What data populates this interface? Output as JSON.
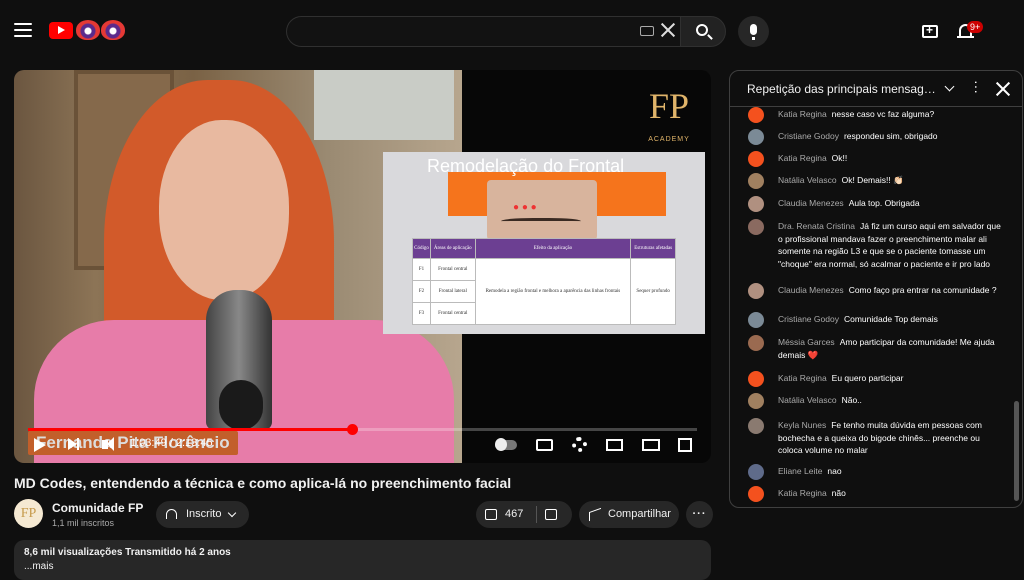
{
  "header": {
    "notification_count": "9+",
    "search_placeholder": ""
  },
  "player": {
    "slide_title": "Remodelação do Frontal",
    "logo_text": "FP",
    "logo_sub": "ACADEMY",
    "slide_table": {
      "headers": [
        "Código",
        "Áreas de aplicação",
        "Efeito da aplicação",
        "Estruturas afetadas"
      ],
      "rows": [
        [
          "F1",
          "Frontal central",
          "",
          ""
        ],
        [
          "F2",
          "Frontal lateral",
          "Remodela a região frontal e melhora a aparência das linhas frontais",
          "Sequer profundo"
        ],
        [
          "F3",
          "Frontal central",
          "",
          ""
        ]
      ]
    },
    "overlay_name": "Fernanda Pita Florêncio",
    "time_display": "1:03:49 / 2:13:45",
    "progress_fraction": 0.484
  },
  "video": {
    "title": "MD Codes, entendendo a técnica e como aplica-lá no preenchimento facial",
    "channel_name": "Comunidade FP",
    "channel_avatar": "FP",
    "subscribers": "1,1 mil inscritos",
    "subscribe_label": "Inscrito",
    "likes": "467",
    "share_label": "Compartilhar",
    "more_label": "···",
    "views_meta": "8,6 mil visualizações  Transmitido há 2 anos",
    "desc_more": "...mais"
  },
  "chat": {
    "title": "Repetição das principais mensagen...",
    "messages": [
      {
        "author": "Katia Regina",
        "text": "nesse caso vc faz alguma?",
        "color": "#f4511e"
      },
      {
        "author": "Cristiane Godoy",
        "text": "respondeu sim, obrigado",
        "color": "#7b8a96"
      },
      {
        "author": "Katia Regina",
        "text": "Ok!!",
        "color": "#f4511e"
      },
      {
        "author": "Natália Velasco",
        "text": "Ok! Demais!! 👏🏻",
        "color": "#a08060"
      },
      {
        "author": "Claudia Menezes",
        "text": "Aula top. Obrigada",
        "color": "#b09080"
      },
      {
        "author": "Dra. Renata Cristina",
        "text": "Já fiz um curso aqui em salvador que o profissional mandava fazer o preenchimento malar ali somente na região L3 e que se o paciente tomasse um \"choque\" era normal, só acalmar o paciente e ir pro lado",
        "color": "#8a6a60"
      },
      {
        "author": "Claudia Menezes",
        "text": "Como faço pra entrar na comunidade ?",
        "color": "#b09080"
      },
      {
        "author": "Cristiane Godoy",
        "text": "Comunidade Top demais",
        "color": "#7b8a96"
      },
      {
        "author": "Méssia Garces",
        "text": "Amo participar da comunidade! Me ajuda demais ❤️",
        "color": "#9a6a50"
      },
      {
        "author": "Katia Regina",
        "text": "Eu quero participar",
        "color": "#f4511e"
      },
      {
        "author": "Natália Velasco",
        "text": "Não..",
        "color": "#a08060"
      },
      {
        "author": "Keyla Nunes",
        "text": "Fe tenho muita dúvida em pessoas com bochecha e a queixa do bigode chinês... preenche ou coloca volume no malar",
        "color": "#8a7a70"
      },
      {
        "author": "Eliane Leite",
        "text": "nao",
        "color": "#5f6b8a"
      },
      {
        "author": "Katia Regina",
        "text": "não",
        "color": "#f4511e"
      }
    ]
  },
  "colors": {
    "accent": "#ff0000",
    "background": "#0f0f0f",
    "pill": "#272727"
  }
}
